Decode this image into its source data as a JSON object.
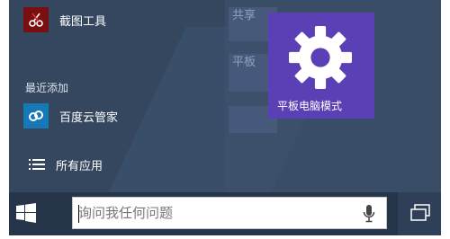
{
  "start_menu": {
    "apps": [
      {
        "label": "截图工具",
        "icon": "scissors-icon"
      },
      {
        "label": "百度云管家",
        "icon": "baidu-cloud-icon"
      }
    ],
    "recently_added_label": "最近添加",
    "all_apps_label": "所有应用",
    "background_tiles": [
      "共享",
      "平板"
    ],
    "tile": {
      "label": "平板电脑模式",
      "icon": "gear-icon",
      "color": "#5b3fb5"
    }
  },
  "taskbar": {
    "search_placeholder": "询问我任何问题",
    "start_icon": "windows-logo-icon",
    "mic_icon": "microphone-icon",
    "task_view_icon": "task-view-icon"
  }
}
